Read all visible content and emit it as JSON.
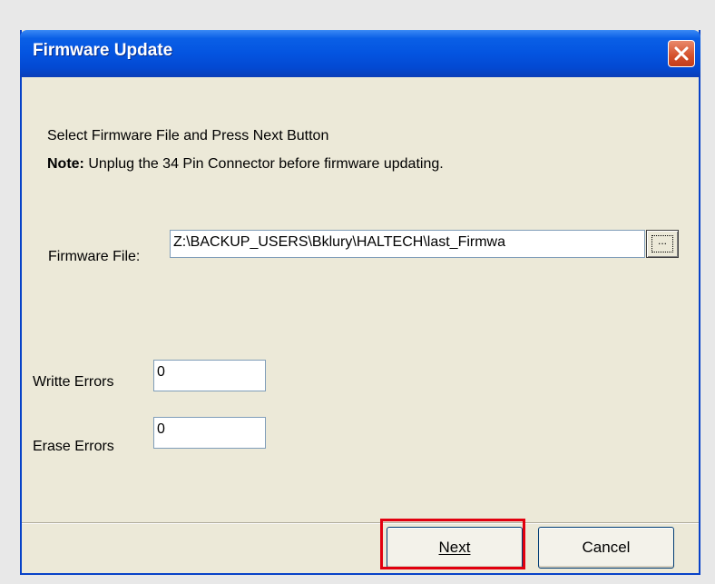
{
  "window": {
    "title": "Firmware Update"
  },
  "instructions": {
    "line1": "Select Firmware File and Press Next Button",
    "note_label": "Note:",
    "note_text": "Unplug the 34 Pin Connector before firmware updating."
  },
  "firmware": {
    "label": "Firmware File:",
    "value": "Z:\\BACKUP_USERS\\Bklury\\HALTECH\\last_Firmwa",
    "browse_label": "..."
  },
  "errors": {
    "write_label": "Writte Errors",
    "write_value": "0",
    "erase_label": "Erase Errors",
    "erase_value": "0"
  },
  "buttons": {
    "next_label": "Next",
    "cancel_label": "Cancel"
  },
  "colors": {
    "title_bar": "#0454e0",
    "window_bg": "#ece9d8",
    "highlight": "#e2000f"
  }
}
